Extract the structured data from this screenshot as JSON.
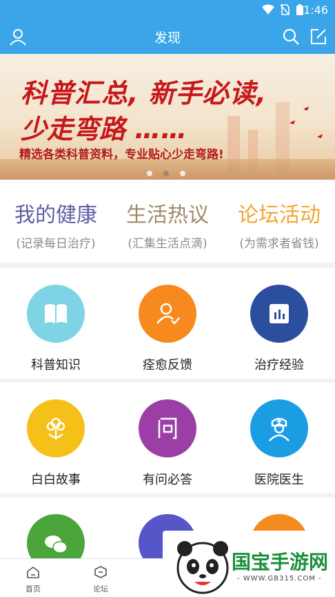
{
  "status_bar": {
    "time": "1:46",
    "icons": [
      "wifi-icon",
      "no-sim-icon",
      "battery-icon"
    ]
  },
  "header": {
    "title": "发现",
    "left_icon": "user-icon",
    "right_icons": [
      "search-icon",
      "edit-icon"
    ],
    "color": "#3aa5e8"
  },
  "banner": {
    "line1": "科普汇总, 新手必读,",
    "line2": "少走弯路 ……",
    "line3": "精选各类科普资料，专业贴心少走弯路!",
    "page_count": 3,
    "active_page": 1
  },
  "categories": [
    {
      "title": "我的健康",
      "subtitle": "(记录每日治疗)",
      "color": "#5b5fa3"
    },
    {
      "title": "生活热议",
      "subtitle": "(汇集生活点滴)",
      "color": "#a08a6a"
    },
    {
      "title": "论坛活动",
      "subtitle": "(为需求者省钱)",
      "color": "#f2a532"
    }
  ],
  "grid": [
    {
      "label": "科普知识",
      "icon": "book-icon",
      "color": "#7ed3e5"
    },
    {
      "label": "痊愈反馈",
      "icon": "user-check-icon",
      "color": "#f68a1e"
    },
    {
      "label": "治疗经验",
      "icon": "chart-icon",
      "color": "#2b4f9e"
    },
    {
      "label": "白白故事",
      "icon": "flower-icon",
      "color": "#f5c118"
    },
    {
      "label": "有问必答",
      "icon": "question-icon",
      "color": "#9b3fa6"
    },
    {
      "label": "医院医生",
      "icon": "doctor-icon",
      "color": "#1a9de3"
    },
    {
      "label": "",
      "icon": "wechat-icon",
      "color": "#4aa53a"
    },
    {
      "label": "",
      "icon": "circle-icon",
      "color": "#5656c9"
    },
    {
      "label": "",
      "icon": "circle-icon",
      "color": "#f58a1f"
    }
  ],
  "tabbar": [
    {
      "label": "首页",
      "icon": "home-icon"
    },
    {
      "label": "论坛",
      "icon": "forum-icon"
    }
  ],
  "watermark": {
    "brand": "国宝手游网",
    "url": "- WWW.GB315.COM -"
  }
}
